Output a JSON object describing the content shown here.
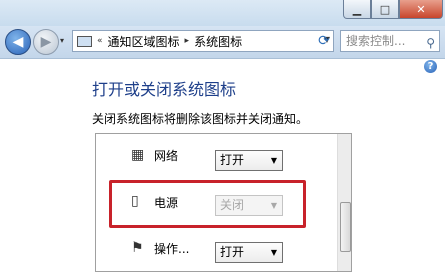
{
  "window": {
    "minimize_icon": "minimize-icon",
    "maximize_icon": "maximize-icon",
    "close_icon": "close-icon"
  },
  "nav": {
    "recent_glyph": "▾",
    "breadcrumb_prefix": "«",
    "breadcrumb": [
      "通知区域图标",
      "系统图标"
    ],
    "separator": "▸",
    "search_placeholder": "搜索控制...",
    "help_glyph": "?"
  },
  "page": {
    "heading": "打开或关闭系统图标",
    "description": "关闭系统图标将删除该图标并关闭通知。"
  },
  "rows": [
    {
      "label": "网络",
      "icon": "network-icon",
      "value": "打开",
      "disabled": false
    },
    {
      "label": "电源",
      "icon": "power-icon",
      "value": "关闭",
      "disabled": true
    },
    {
      "label": "操作...",
      "icon": "flag-icon",
      "value": "打开",
      "disabled": false
    }
  ],
  "colors": {
    "heading": "#1e3f8a",
    "highlight_border": "#c8222a"
  }
}
